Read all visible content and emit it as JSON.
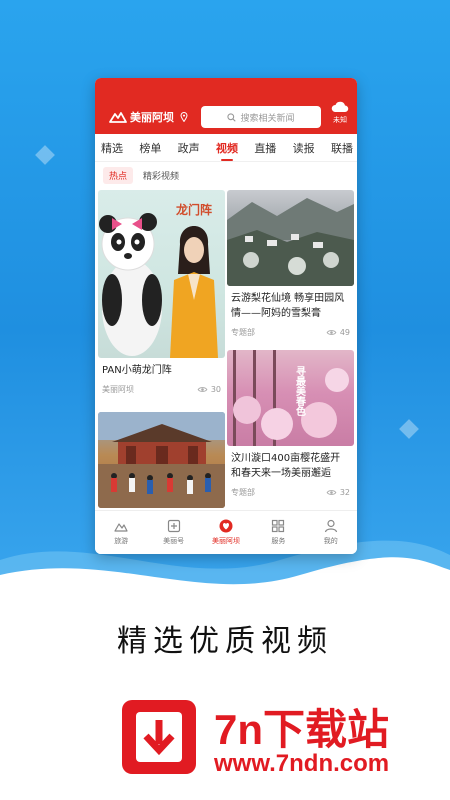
{
  "header": {
    "logo_text": "美丽阿坝",
    "search_placeholder": "搜索相关新闻",
    "weather_label": "未知"
  },
  "tabs": [
    {
      "label": "精选",
      "active": false
    },
    {
      "label": "榜单",
      "active": false
    },
    {
      "label": "政声",
      "active": false
    },
    {
      "label": "视频",
      "active": true
    },
    {
      "label": "直播",
      "active": false
    },
    {
      "label": "读报",
      "active": false
    },
    {
      "label": "联播",
      "active": false
    }
  ],
  "subtabs": [
    {
      "label": "热点",
      "active": true
    },
    {
      "label": "精彩视频",
      "active": false
    }
  ],
  "cards": {
    "panda": {
      "title": "PAN小萌龙门阵",
      "source": "美丽阿坝",
      "views": "30",
      "thumb_text": "龙门阵"
    },
    "village": {
      "title": "云游梨花仙境 畅享田园风情——阿妈的雪梨膏",
      "source": "专题部",
      "views": "49"
    },
    "blossom": {
      "title": "汶川漩口400亩樱花盛开 和春天来一场美丽邂逅",
      "source": "专题部",
      "views": "32",
      "thumb_text": "寻最美春色"
    },
    "temple": {
      "title": ""
    }
  },
  "bottom_nav": [
    {
      "label": "旅游",
      "icon": "mountain-icon",
      "active": false
    },
    {
      "label": "美丽号",
      "icon": "plus-square-icon",
      "active": false
    },
    {
      "label": "美丽阿坝",
      "icon": "heart-circle-icon",
      "active": true
    },
    {
      "label": "服务",
      "icon": "grid-icon",
      "active": false
    },
    {
      "label": "我的",
      "icon": "user-icon",
      "active": false
    }
  ],
  "promo": {
    "slogan": "精选优质视频",
    "brand_name": "7n下载站",
    "brand_url": "www.7ndn.com"
  },
  "colors": {
    "brand_red": "#e12a22",
    "promo_blue": "#2aa4ee"
  }
}
